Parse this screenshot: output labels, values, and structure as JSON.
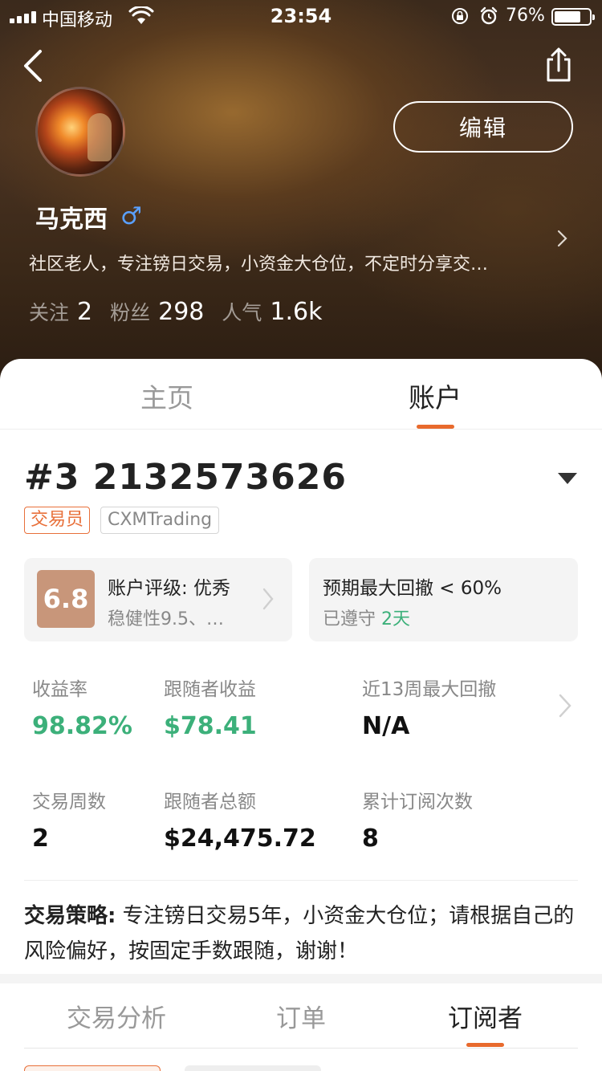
{
  "status_bar": {
    "carrier": "中国移动",
    "time": "23:54",
    "battery_percent": "76%",
    "battery_level": 0.76,
    "signal_bars": 4
  },
  "profile": {
    "name": "马克西",
    "gender_symbol": "♂",
    "bio": "社区老人，专注镑日交易，小资金大仓位，不定时分享交…",
    "edit_label": "编辑",
    "stats": [
      {
        "label": "关注",
        "value": "2"
      },
      {
        "label": "粉丝",
        "value": "298"
      },
      {
        "label": "人气",
        "value": "1.6k"
      }
    ]
  },
  "tabs": [
    {
      "label": "主页",
      "active": false
    },
    {
      "label": "账户",
      "active": true
    }
  ],
  "account": {
    "title": "#3 2132573626",
    "tags": [
      "交易员",
      "CXMTrading"
    ],
    "rating": {
      "score": "6.8",
      "title": "账户评级: 优秀",
      "subtitle": "稳健性9.5、…"
    },
    "drawdown": {
      "title": "预期最大回撤 < 60%",
      "kept_label": "已遵守",
      "kept_days": "2天"
    },
    "metrics": [
      {
        "label": "收益率",
        "value": "98.82%",
        "highlight": true
      },
      {
        "label": "跟随者收益",
        "value": "$78.41",
        "highlight": true
      },
      {
        "label": "近13周最大回撤",
        "value": "N/A",
        "highlight": false
      },
      {
        "label": "交易周数",
        "value": "2",
        "highlight": false
      },
      {
        "label": "跟随者总额",
        "value": "$24,475.72",
        "highlight": false
      },
      {
        "label": "累计订阅次数",
        "value": "8",
        "highlight": false
      }
    ],
    "strategy_label": "交易策略:",
    "strategy_text": "专注镑日交易5年，小资金大仓位；请根据自己的风险偏好，按固定手数跟随，谢谢！"
  },
  "subtabs": [
    {
      "label": "交易分析",
      "active": false
    },
    {
      "label": "订单",
      "active": false
    },
    {
      "label": "订阅者",
      "active": true
    }
  ],
  "colors": {
    "accent": "#e86a2d",
    "positive": "#3cb07a",
    "badge": "#c8967a",
    "gender": "#5aa0ff"
  }
}
